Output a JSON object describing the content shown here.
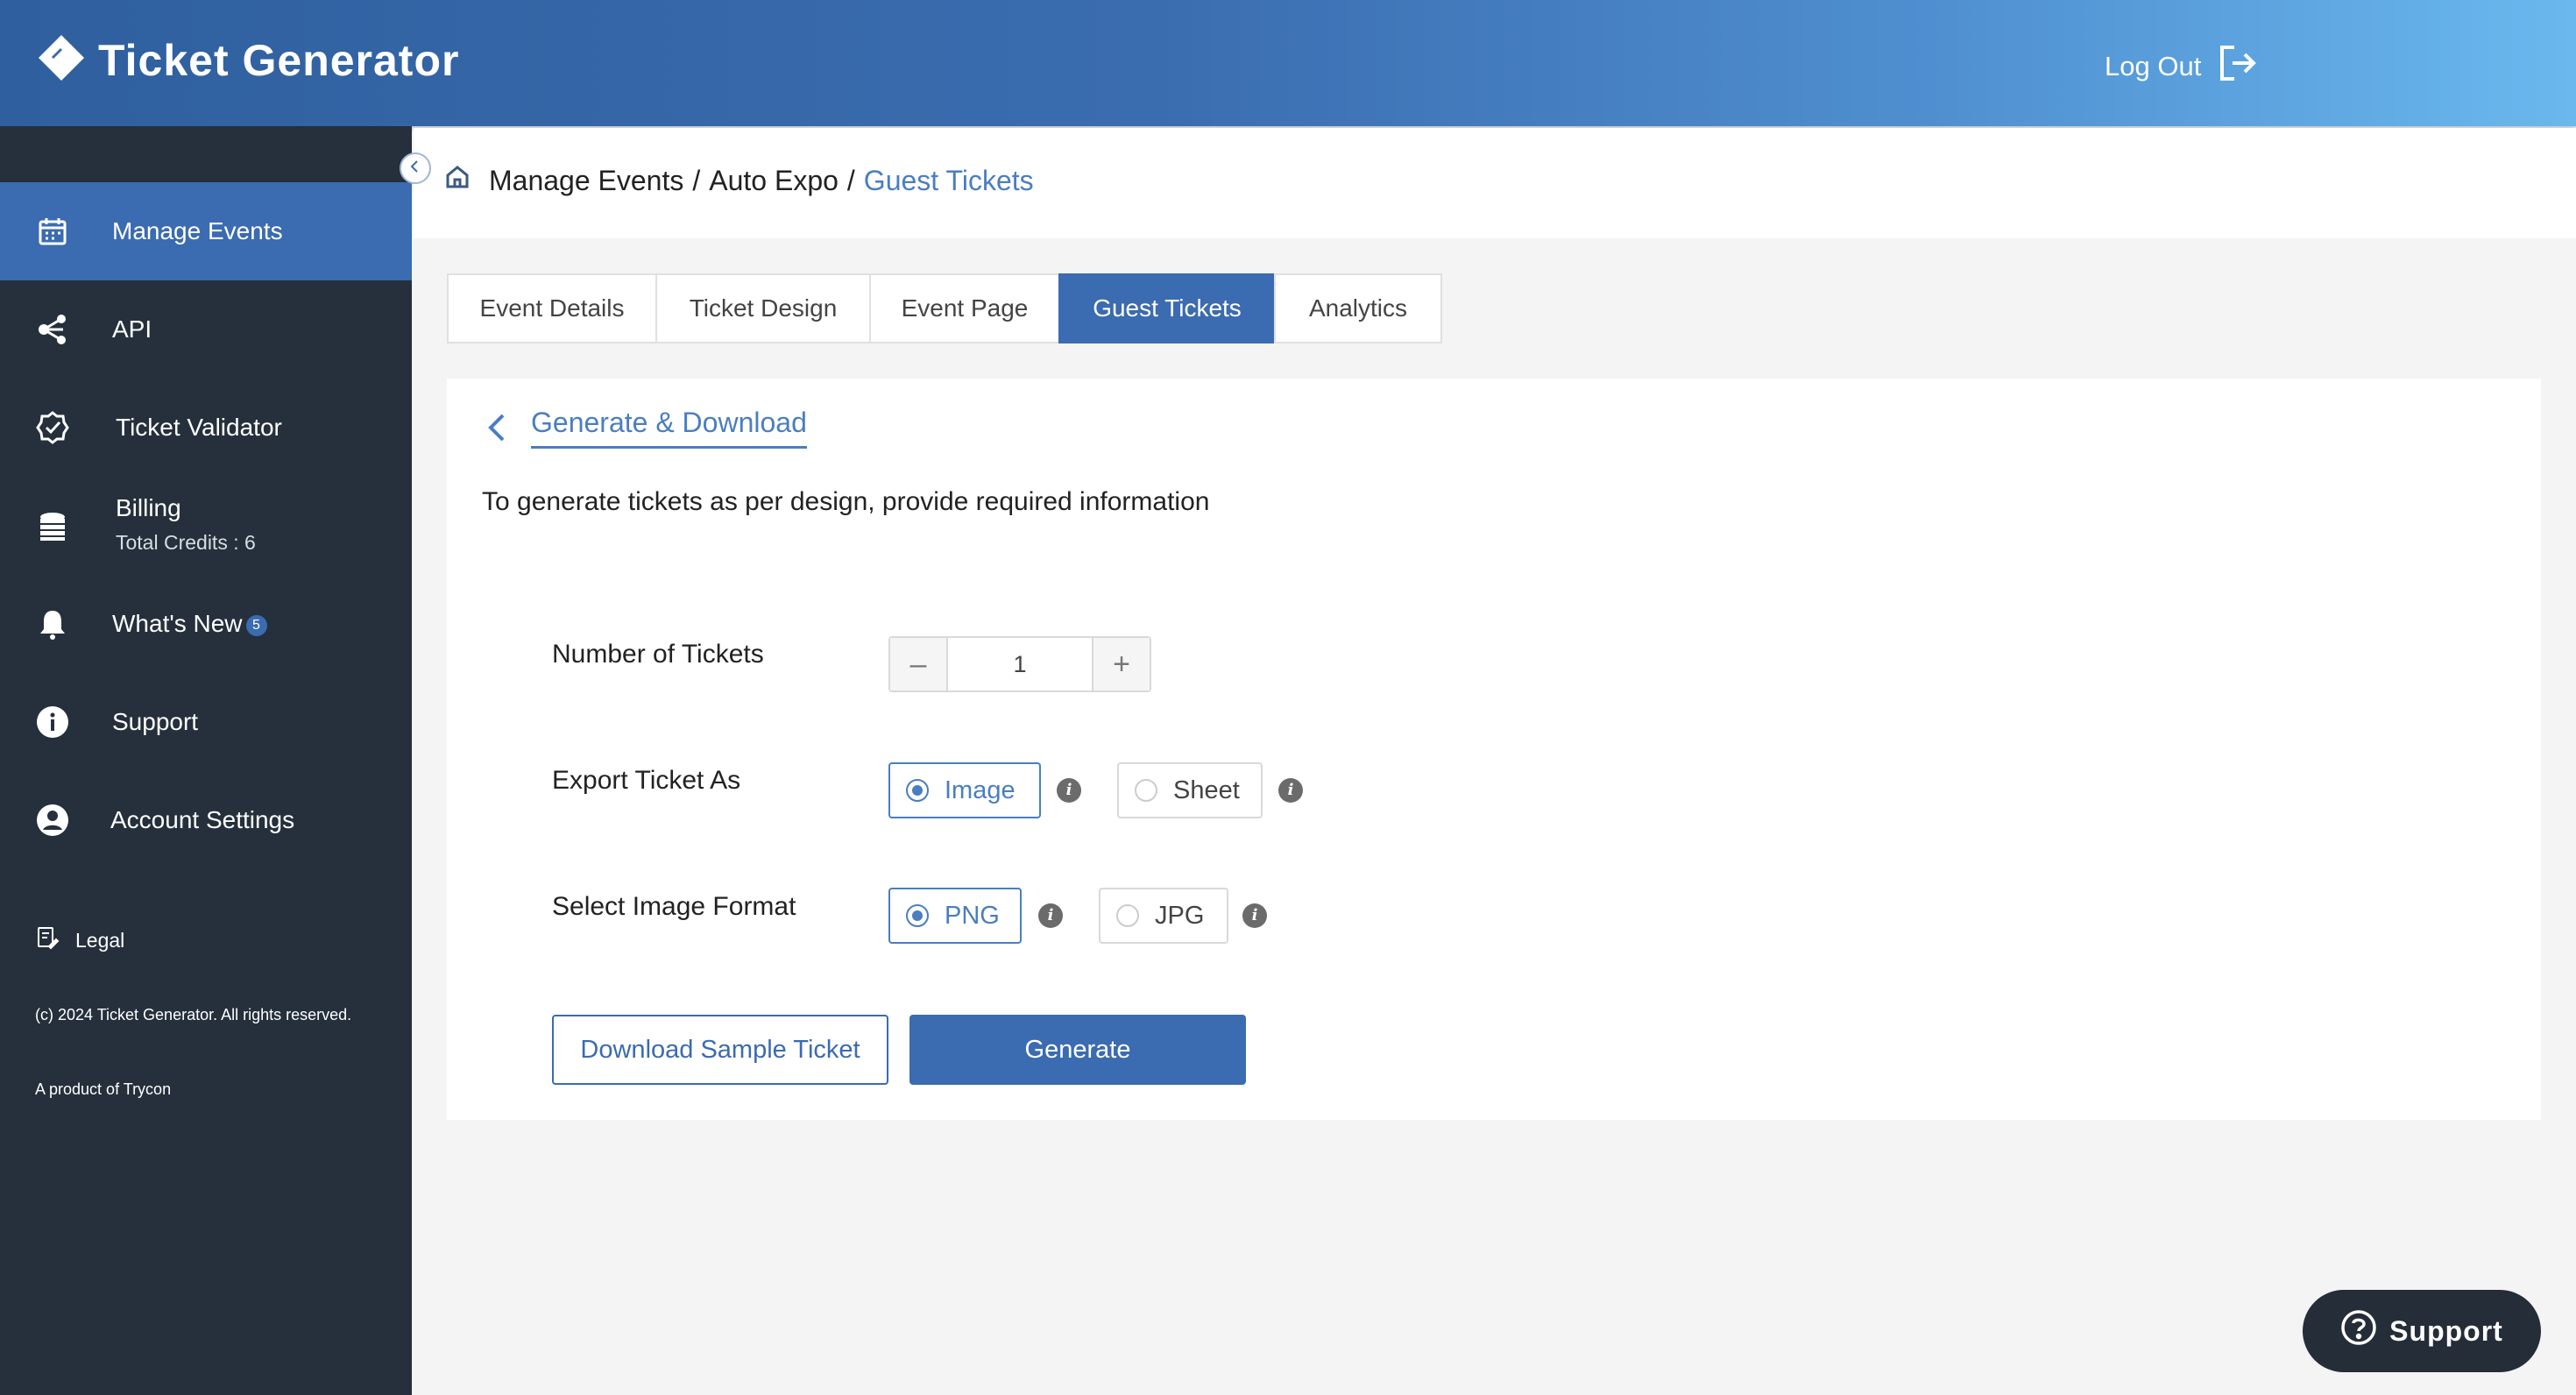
{
  "header": {
    "brand": "Ticket Generator",
    "logout_label": "Log Out"
  },
  "sidebar": {
    "items": [
      {
        "label": "Manage Events",
        "icon": "calendar-icon",
        "active": true
      },
      {
        "label": "API",
        "icon": "share-icon"
      },
      {
        "label": "Ticket Validator",
        "icon": "check-badge-icon"
      },
      {
        "label": "Billing",
        "sublabel": "Total Credits : 6",
        "icon": "coins-icon"
      },
      {
        "label": "What's New",
        "badge": "5",
        "icon": "bell-icon"
      },
      {
        "label": "Support",
        "icon": "info-icon"
      },
      {
        "label": "Account Settings",
        "icon": "user-circle-icon"
      }
    ],
    "legal_label": "Legal",
    "copyright": "(c) 2024 Ticket Generator. All rights reserved.",
    "product_of": "A product of Trycon"
  },
  "breadcrumb": {
    "items": [
      "Manage Events",
      "Auto Expo",
      "Guest Tickets"
    ],
    "separator": "/"
  },
  "tabs": [
    {
      "label": "Event Details"
    },
    {
      "label": "Ticket Design"
    },
    {
      "label": "Event Page"
    },
    {
      "label": "Guest Tickets",
      "active": true
    },
    {
      "label": "Analytics"
    }
  ],
  "form": {
    "title": "Generate & Download",
    "description": "To generate tickets as per design, provide required information",
    "num_tickets_label": "Number of Tickets",
    "num_tickets_value": "1",
    "minus": "–",
    "plus": "+",
    "export_label": "Export Ticket As",
    "export_options": [
      {
        "label": "Image",
        "selected": true
      },
      {
        "label": "Sheet",
        "selected": false
      }
    ],
    "format_label": "Select Image Format",
    "format_options": [
      {
        "label": "PNG",
        "selected": true
      },
      {
        "label": "JPG",
        "selected": false
      }
    ],
    "info_glyph": "i",
    "download_sample_label": "Download Sample Ticket",
    "generate_label": "Generate"
  },
  "support_fab": {
    "label": "Support"
  },
  "colors": {
    "primary": "#3b6bb0",
    "link": "#4a7ec0",
    "sidebar_bg": "#25303c",
    "page_bg": "#f4f4f4"
  }
}
